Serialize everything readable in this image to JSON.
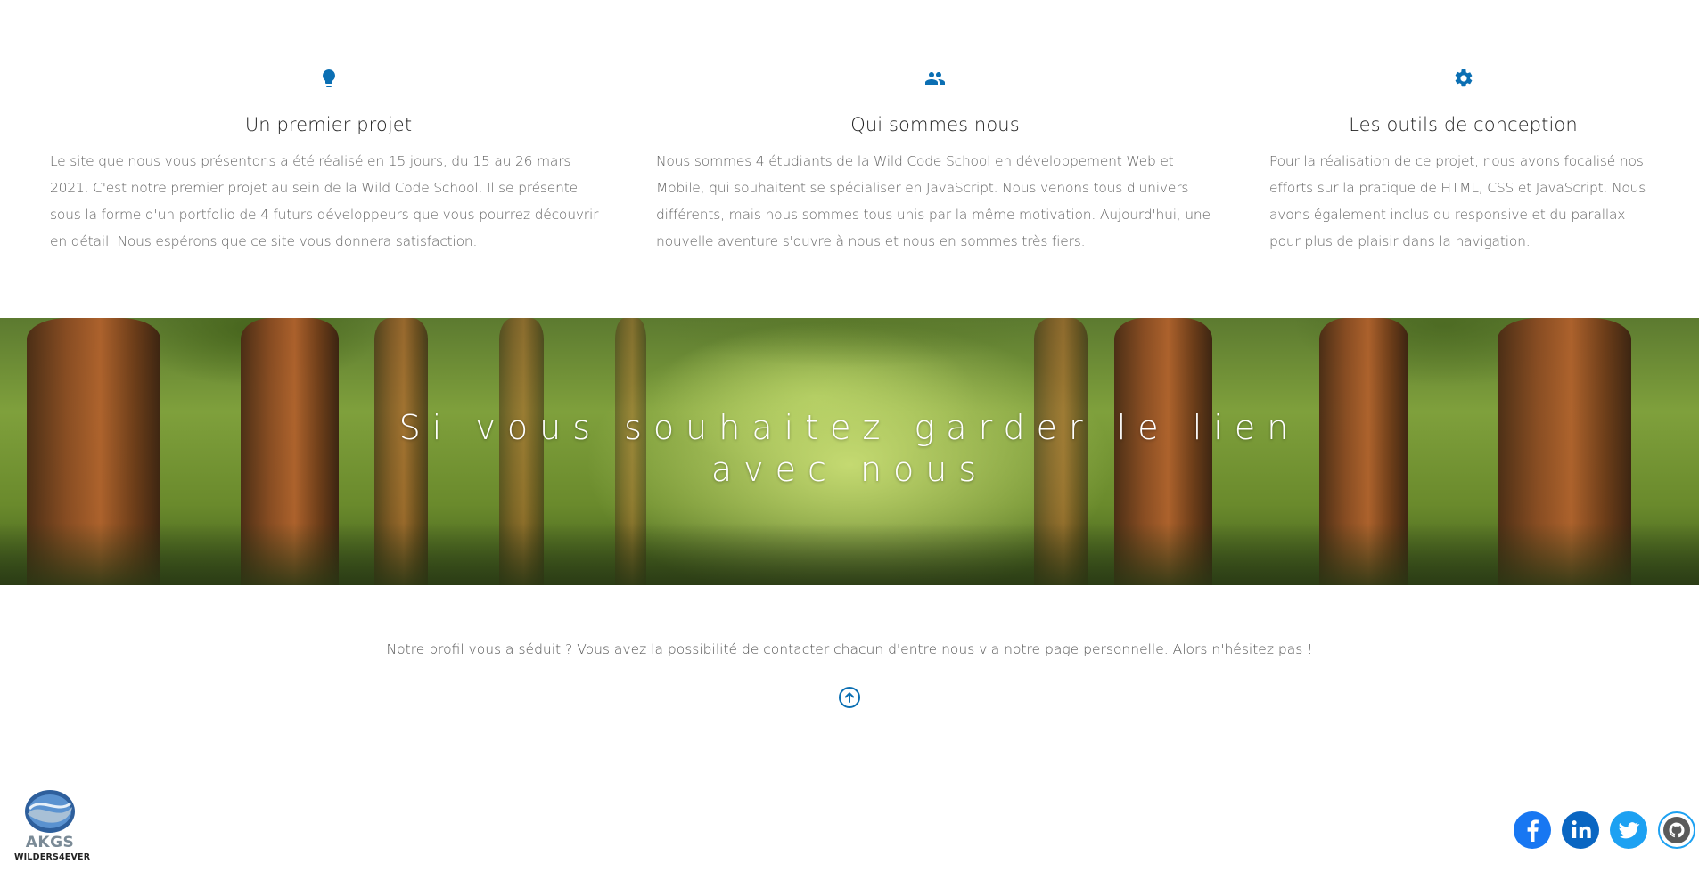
{
  "features": [
    {
      "icon": "lightbulb-icon",
      "title": "Un premier projet",
      "text": "Le site que nous vous présentons a été réalisé en 15 jours, du 15 au 26 mars 2021. C'est notre premier projet au sein de la Wild Code School. Il se présente sous la forme d'un portfolio de 4 futurs développeurs que vous pourrez découvrir en détail. Nous espérons que ce site vous donnera satisfaction."
    },
    {
      "icon": "people-icon",
      "title": "Qui sommes nous",
      "text": "Nous sommes 4 étudiants de la Wild Code School en développement Web et Mobile, qui souhaitent se spécialiser en JavaScript. Nous venons tous d'univers différents, mais nous sommes tous unis par la même motivation. Aujourd'hui, une nouvelle aventure s'ouvre à nous et nous en sommes très fiers."
    },
    {
      "icon": "gear-icon",
      "title": "Les outils de conception",
      "text": "Pour la réalisation de ce projet, nous avons focalisé nos efforts sur la pratique de HTML, CSS et JavaScript. Nous avons également inclus du responsive et du parallax pour plus de plaisir dans la navigation."
    }
  ],
  "banner": {
    "heading": "Si vous souhaitez garder le lien avec nous"
  },
  "contact": {
    "text": "Notre profil vous a séduit ? Vous avez la possibilité de contacter chacun d'entre nous via notre page personnelle. Alors n'hésitez pas !",
    "back_to_top_icon": "arrow-up-circle-icon"
  },
  "footer": {
    "logo_brand": "AKGS",
    "logo_tagline": "WILDERS4EVER",
    "socials": [
      "facebook-icon",
      "linkedin-icon",
      "twitter-icon",
      "github-icon"
    ]
  },
  "colors": {
    "accent": "#0b6fb3",
    "facebook": "#1877f2",
    "linkedin": "#0a66c2",
    "twitter": "#1da1f2",
    "github_ring": "#1da1f2"
  }
}
